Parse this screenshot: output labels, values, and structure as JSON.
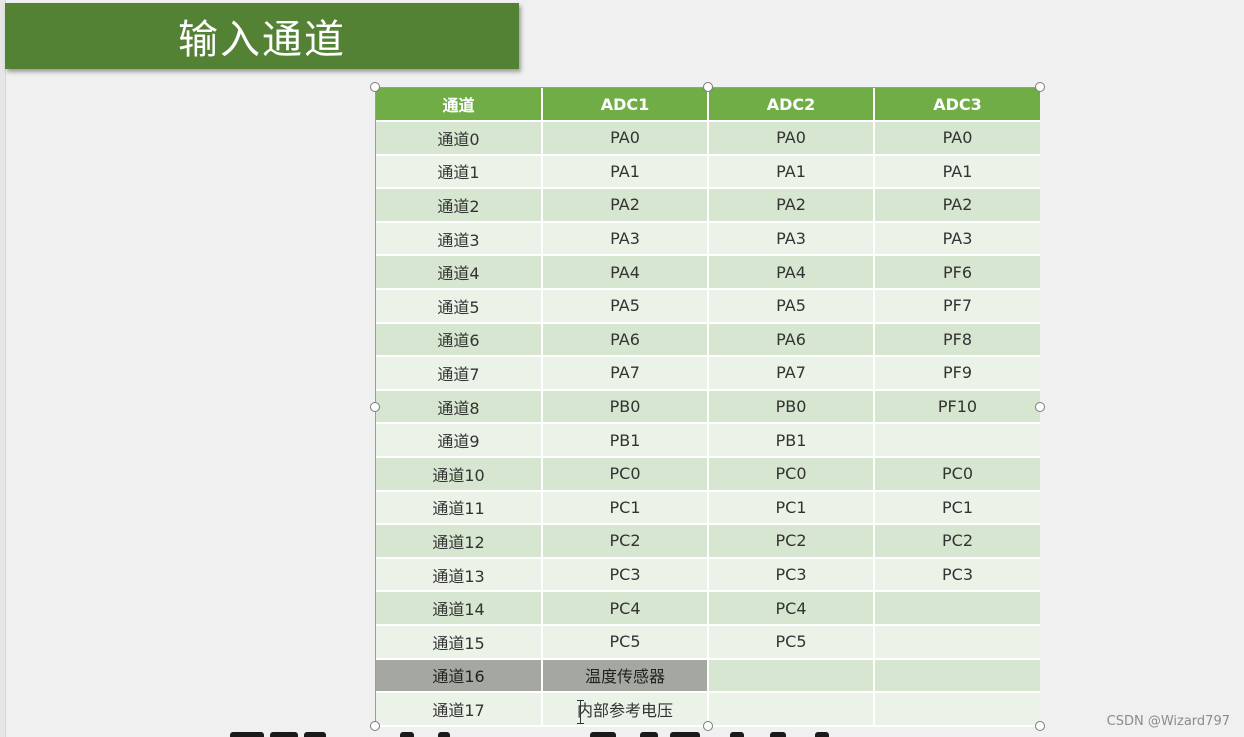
{
  "title": "输入通道",
  "colors": {
    "banner": "#548235",
    "header": "#70ad47",
    "row_dark": "#d6e6d0",
    "row_light": "#ebf3e8",
    "selected_cell": "#a5a8a0"
  },
  "table": {
    "headers": [
      "通道",
      "ADC1",
      "ADC2",
      "ADC3"
    ],
    "rows": [
      [
        "通道0",
        "PA0",
        "PA0",
        "PA0"
      ],
      [
        "通道1",
        "PA1",
        "PA1",
        "PA1"
      ],
      [
        "通道2",
        "PA2",
        "PA2",
        "PA2"
      ],
      [
        "通道3",
        "PA3",
        "PA3",
        "PA3"
      ],
      [
        "通道4",
        "PA4",
        "PA4",
        "PF6"
      ],
      [
        "通道5",
        "PA5",
        "PA5",
        "PF7"
      ],
      [
        "通道6",
        "PA6",
        "PA6",
        "PF8"
      ],
      [
        "通道7",
        "PA7",
        "PA7",
        "PF9"
      ],
      [
        "通道8",
        "PB0",
        "PB0",
        "PF10"
      ],
      [
        "通道9",
        "PB1",
        "PB1",
        ""
      ],
      [
        "通道10",
        "PC0",
        "PC0",
        "PC0"
      ],
      [
        "通道11",
        "PC1",
        "PC1",
        "PC1"
      ],
      [
        "通道12",
        "PC2",
        "PC2",
        "PC2"
      ],
      [
        "通道13",
        "PC3",
        "PC3",
        "PC3"
      ],
      [
        "通道14",
        "PC4",
        "PC4",
        ""
      ],
      [
        "通道15",
        "PC5",
        "PC5",
        ""
      ],
      [
        "通道16",
        "温度传感器",
        "",
        ""
      ],
      [
        "通道17",
        "内部参考电压",
        "",
        ""
      ]
    ]
  },
  "watermark": "CSDN @Wizard797"
}
